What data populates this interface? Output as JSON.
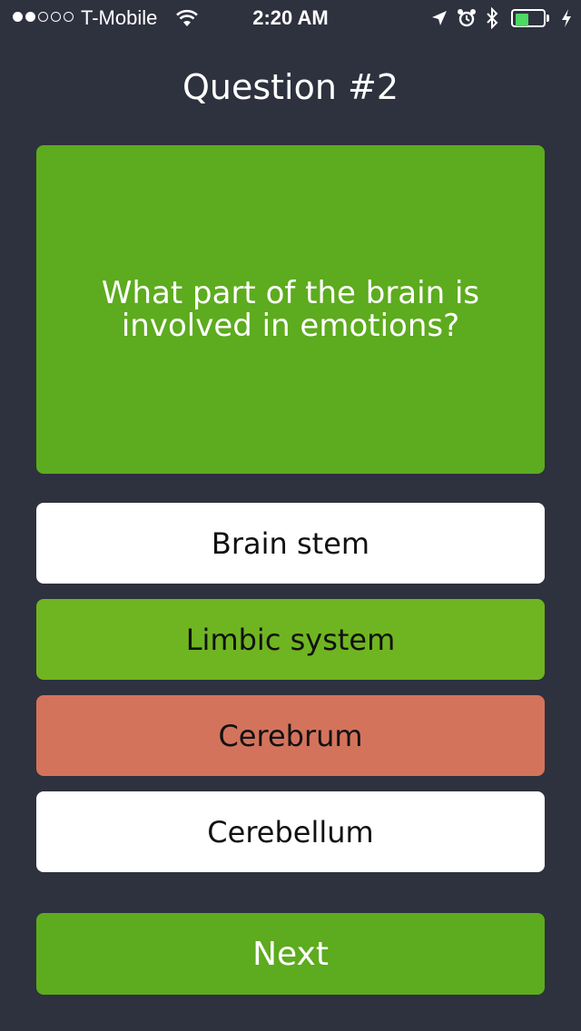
{
  "status_bar": {
    "signal_strength": 2,
    "signal_max": 5,
    "carrier": "T-Mobile",
    "time": "2:20 AM",
    "battery_level": 0.45,
    "battery_color": "#4cd964",
    "icons": [
      "wifi-icon",
      "location-icon",
      "alarm-icon",
      "bluetooth-icon",
      "charging-icon"
    ]
  },
  "quiz": {
    "title": "Question #2",
    "question": "What part of the brain is involved in emotions?",
    "answers": [
      {
        "label": "Brain stem",
        "state": "neutral",
        "color": "#ffffff"
      },
      {
        "label": "Limbic system",
        "state": "correct",
        "color": "#6fb521"
      },
      {
        "label": "Cerebrum",
        "state": "incorrect",
        "color": "#d4735c"
      },
      {
        "label": "Cerebellum",
        "state": "neutral",
        "color": "#ffffff"
      }
    ],
    "next_label": "Next"
  },
  "colors": {
    "background": "#2e313e",
    "accent_green": "#5dab1e",
    "correct_green": "#6fb521",
    "incorrect_red": "#d4735c"
  }
}
